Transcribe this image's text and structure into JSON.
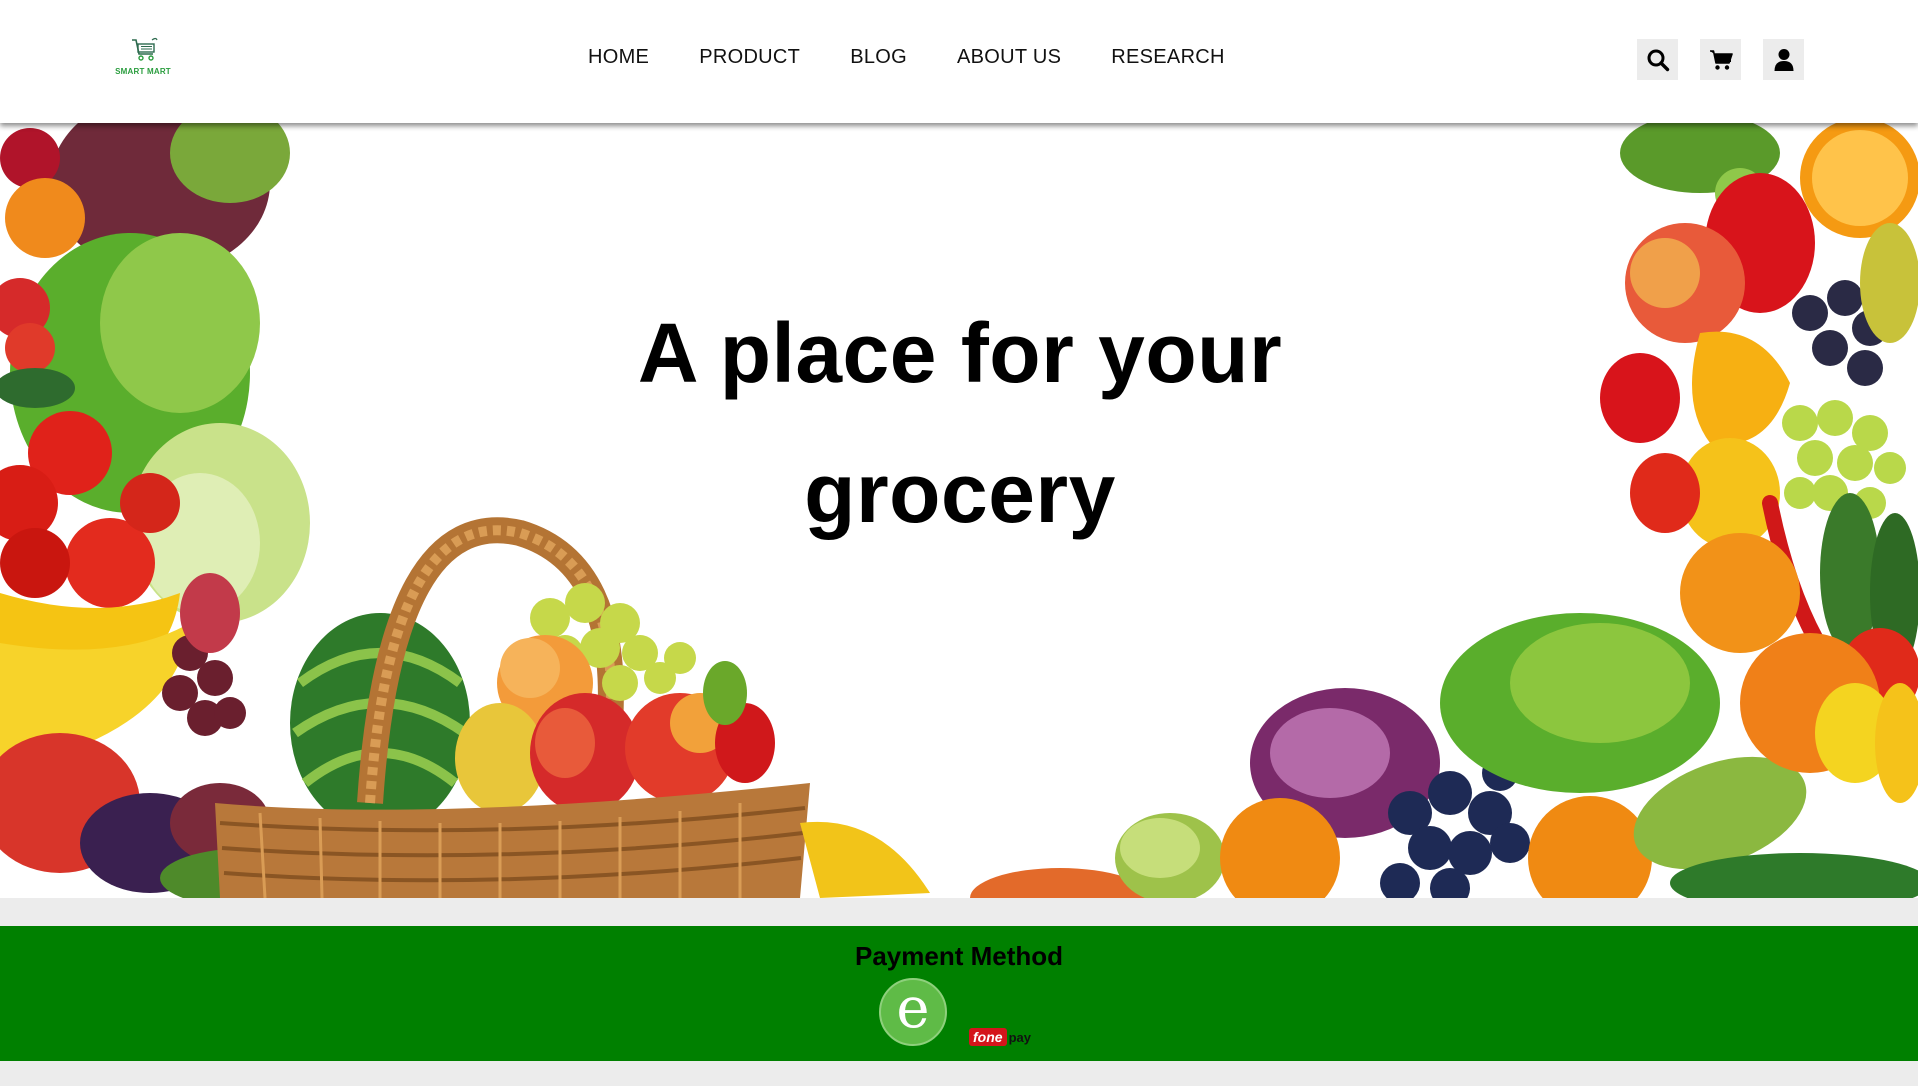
{
  "brand": {
    "logo_text": "SMART MART",
    "logo_icon": "shopping-cart-icon",
    "accent": "#2a9d3e"
  },
  "nav": {
    "items": [
      {
        "label": "HOME"
      },
      {
        "label": "PRODUCT"
      },
      {
        "label": "BLOG"
      },
      {
        "label": "ABOUT US"
      },
      {
        "label": "RESEARCH"
      }
    ]
  },
  "header_actions": [
    {
      "icon": "search-icon"
    },
    {
      "icon": "cart-icon"
    },
    {
      "icon": "user-icon"
    }
  ],
  "hero": {
    "title_line1": "A place for your",
    "title_line2": "grocery",
    "image": "fresh vegetables and fruit basket banner"
  },
  "payment": {
    "title": "Payment Method",
    "color": "#008000",
    "methods": [
      {
        "name": "eSewa",
        "glyph": "e"
      },
      {
        "brand_part1": "fone",
        "brand_part2": "pay"
      }
    ]
  }
}
